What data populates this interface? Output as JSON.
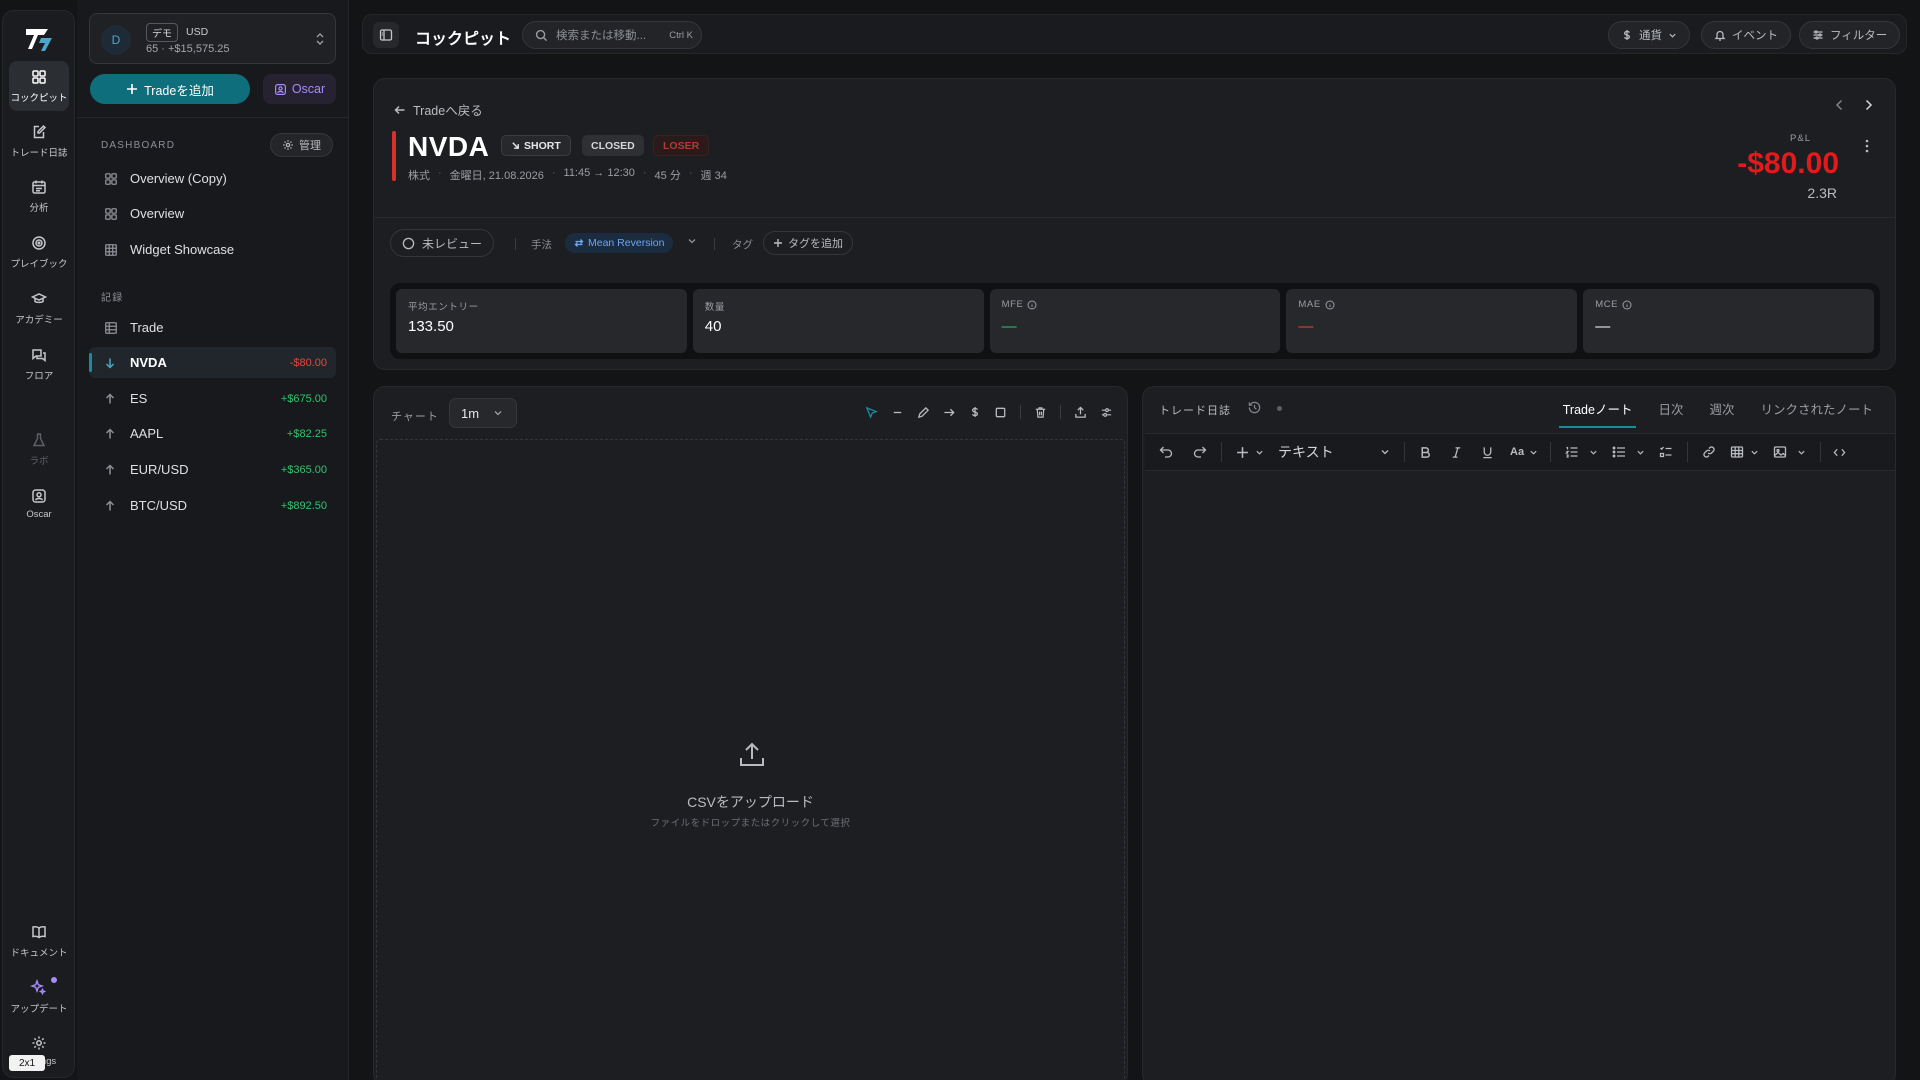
{
  "rail": {
    "items": [
      {
        "label": "コックピット",
        "icon": "grid-icon"
      },
      {
        "label": "トレード日誌",
        "icon": "journal-edit-icon"
      },
      {
        "label": "分析",
        "icon": "calendar-chart-icon"
      },
      {
        "label": "プレイブック",
        "icon": "target-icon"
      },
      {
        "label": "アカデミー",
        "icon": "graduation-cap-icon"
      },
      {
        "label": "フロア",
        "icon": "chat-icon"
      },
      {
        "label": "ラボ",
        "icon": "flask-icon"
      },
      {
        "label": "Oscar",
        "icon": "oscar-icon"
      },
      {
        "label": "ドキュメント",
        "icon": "book-icon"
      },
      {
        "label": "アップデート",
        "icon": "sparkle-icon"
      },
      {
        "label": "Settings",
        "icon": "gear-icon"
      }
    ],
    "badge": "2x1"
  },
  "account": {
    "avatar": "D",
    "tag": "デモ",
    "currency": "USD",
    "summary": "65 · +$15,575.25"
  },
  "sidebar": {
    "add_trade": "Tradeを追加",
    "oscar": "Oscar",
    "dashboard_heading": "DASHBOARD",
    "manage": "管理",
    "dashboards": [
      {
        "label": "Overview (Copy)"
      },
      {
        "label": "Overview"
      },
      {
        "label": "Widget Showcase"
      }
    ],
    "records_heading": "記録",
    "records_trade": "Trade",
    "trades": [
      {
        "symbol": "NVDA",
        "pnl": "-$80.00",
        "dir": "down"
      },
      {
        "symbol": "ES",
        "pnl": "+$675.00",
        "dir": "up"
      },
      {
        "symbol": "AAPL",
        "pnl": "+$82.25",
        "dir": "up"
      },
      {
        "symbol": "EUR/USD",
        "pnl": "+$365.00",
        "dir": "up"
      },
      {
        "symbol": "BTC/USD",
        "pnl": "+$892.50",
        "dir": "up"
      }
    ]
  },
  "topbar": {
    "title": "コックピット",
    "search_placeholder": "検索または移動...",
    "search_kbd": "Ctrl K",
    "currency": "通貨",
    "events": "イベント",
    "filter": "フィルター"
  },
  "trade": {
    "back": "Tradeへ戻る",
    "ticker": "NVDA",
    "direction": "SHORT",
    "status": "CLOSED",
    "outcome": "LOSER",
    "meta": [
      "株式",
      "金曜日, 21.08.2026",
      "11:45 → 12:30",
      "45 分",
      "週 34"
    ],
    "pnl_label": "P&L",
    "pnl": "-$80.00",
    "r_multiple": "2.3R",
    "review": "未レビュー",
    "method_label": "手法",
    "method": "Mean Reversion",
    "tag_label": "タグ",
    "add_tag": "タグを追加",
    "stats": [
      {
        "key": "平均エントリー",
        "value": "133.50",
        "info": false,
        "tone": "plain"
      },
      {
        "key": "数量",
        "value": "40",
        "info": false,
        "tone": "plain"
      },
      {
        "key": "MFE",
        "value": "—",
        "info": true,
        "tone": "green"
      },
      {
        "key": "MAE",
        "value": "—",
        "info": true,
        "tone": "red"
      },
      {
        "key": "MCE",
        "value": "—",
        "info": true,
        "tone": "plain"
      }
    ]
  },
  "chart_panel": {
    "label": "チャート",
    "timeframe": "1m",
    "upload_title": "CSVをアップロード",
    "upload_sub": "ファイルをドロップまたはクリックして選択"
  },
  "journal": {
    "label": "トレード日誌",
    "tabs": [
      "Tradeノート",
      "日次",
      "週次",
      "リンクされたノート"
    ],
    "block_type": "テキスト",
    "font_size_label": "Aa"
  },
  "colors": {
    "accent": "#0f6e7c",
    "loss": "#e11b1b",
    "gain": "#31c36d",
    "oscar": "#a78bfa"
  }
}
